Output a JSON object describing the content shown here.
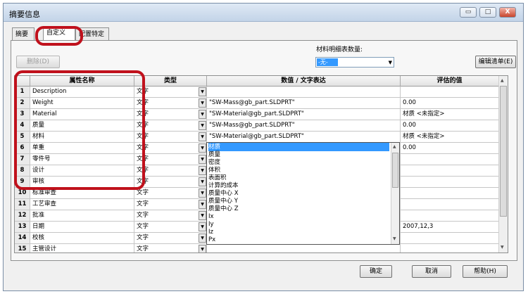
{
  "window": {
    "title": "摘要信息",
    "min_label": "▭",
    "max_label": "□",
    "close_label": "X"
  },
  "tabs": [
    {
      "label": "摘要"
    },
    {
      "label": "自定义"
    },
    {
      "label": "配置特定"
    }
  ],
  "toolbar": {
    "delete_label": "删除(D)",
    "bom_qty_label": "材料明细表数量:",
    "bom_qty_value": "-无-",
    "edit_list_label": "编辑清单(E)"
  },
  "grid": {
    "headers": [
      "",
      "属性名称",
      "类型",
      "数值 / 文字表达",
      "评估的值"
    ],
    "rows": [
      {
        "num": "1",
        "name": "Description",
        "type": "文字",
        "expr": "",
        "value": ""
      },
      {
        "num": "2",
        "name": "Weight",
        "type": "文字",
        "expr": "\"SW-Mass@gb_part.SLDPRT\"",
        "value": "0.00"
      },
      {
        "num": "3",
        "name": "Material",
        "type": "文字",
        "expr": "\"SW-Material@gb_part.SLDPRT\"",
        "value": "材质 <未指定>"
      },
      {
        "num": "4",
        "name": "质量",
        "type": "文字",
        "expr": "\"SW-Mass@gb_part.SLDPRT\"",
        "value": "0.00"
      },
      {
        "num": "5",
        "name": "材料",
        "type": "文字",
        "expr": "\"SW-Material@gb_part.SLDPRT\"",
        "value": "材质 <未指定>"
      },
      {
        "num": "6",
        "name": "单重",
        "type": "文字",
        "expr": "材质",
        "value": "0.00"
      },
      {
        "num": "7",
        "name": "零件号",
        "type": "文字",
        "expr": "",
        "value": ""
      },
      {
        "num": "8",
        "name": "设计",
        "type": "文字",
        "expr": "",
        "value": ""
      },
      {
        "num": "9",
        "name": "审核",
        "type": "文字",
        "expr": "",
        "value": ""
      },
      {
        "num": "10",
        "name": "标准审查",
        "type": "文字",
        "expr": "",
        "value": ""
      },
      {
        "num": "11",
        "name": "工艺审查",
        "type": "文字",
        "expr": "",
        "value": ""
      },
      {
        "num": "12",
        "name": "批准",
        "type": "文字",
        "expr": "",
        "value": ""
      },
      {
        "num": "13",
        "name": "日期",
        "type": "文字",
        "expr": "",
        "value": "2007,12,3"
      },
      {
        "num": "14",
        "name": "校核",
        "type": "文字",
        "expr": "",
        "value": ""
      },
      {
        "num": "15",
        "name": "主管设计",
        "type": "文字",
        "expr": "",
        "value": ""
      }
    ]
  },
  "dropdown": {
    "items": [
      "材质",
      "质量",
      "密度",
      "体积",
      "表面积",
      "计算的成本",
      "质量中心 X",
      "质量中心 Y",
      "质量中心 Z",
      "Ix",
      "Iy",
      "Iz",
      "Px"
    ]
  },
  "footer": {
    "ok_label": "确定",
    "cancel_label": "取消",
    "help_label": "帮助(H)"
  },
  "colors": {
    "highlight": "#3399ff",
    "annotation": "#c0111c"
  }
}
